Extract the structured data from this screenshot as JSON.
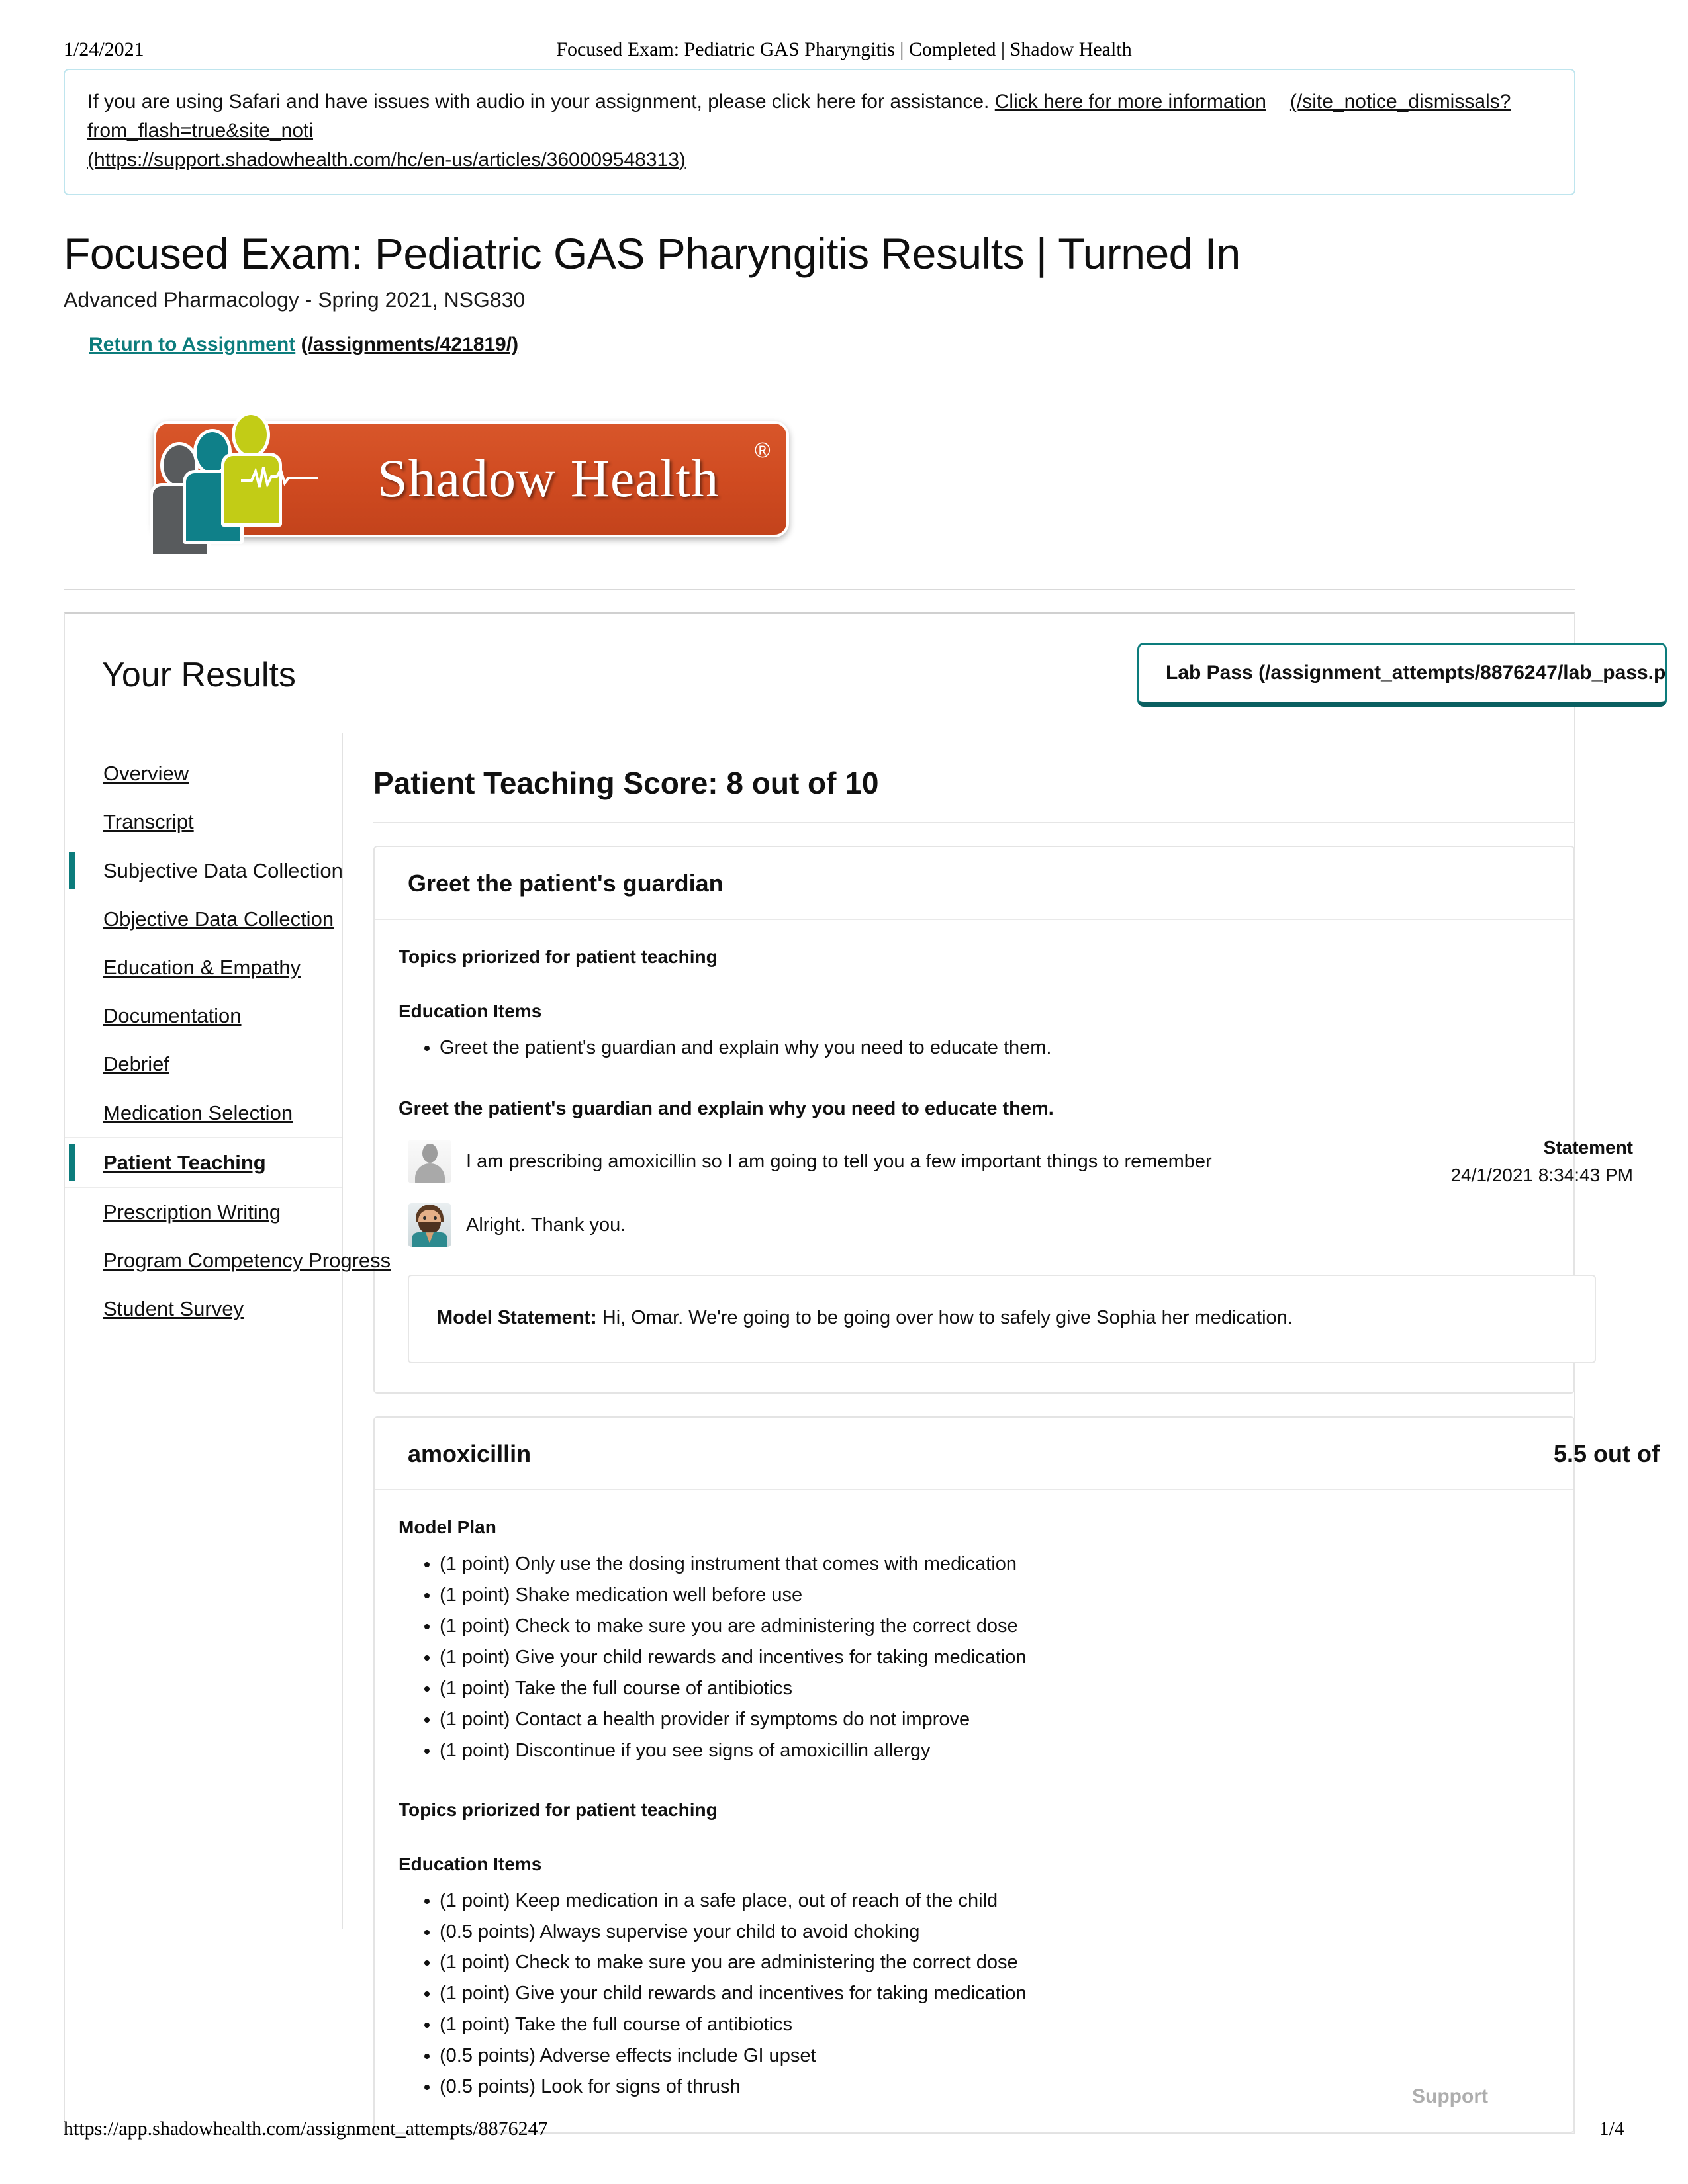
{
  "print": {
    "date": "1/24/2021",
    "header_title": "Focused Exam: Pediatric GAS Pharyngitis | Completed | Shadow Health",
    "footer_url": "https://app.shadowhealth.com/assignment_attempts/8876247",
    "page_number": "1/4"
  },
  "notice": {
    "text": "If you are using Safari and have issues with audio in your assignment, please click here for assistance.",
    "link_label": "Click here for more information",
    "link_url": "(https://support.shadowhealth.com/hc/en-us/articles/360009548313)",
    "dismiss_url": "(/site_notice_dismissals?from_flash=true&site_noti"
  },
  "header": {
    "title": "Focused Exam: Pediatric GAS Pharyngitis Results | Turned In",
    "subtitle": "Advanced Pharmacology - Spring 2021, NSG830",
    "return_link_label": "Return to Assignment",
    "return_link_url": "(/assignments/421819/)"
  },
  "logo": {
    "wordmark": "Shadow Health",
    "registered_mark": "®",
    "rx_mark": "x",
    "plate_color": "#cf4a20",
    "figure_colors": [
      "#585b5d",
      "#0f8089",
      "#c2cc16"
    ]
  },
  "results": {
    "panel_title": "Your Results",
    "lab_pass_label": "Lab Pass (/assignment_attempts/8876247/lab_pass.p",
    "accent_color": "#0c7c7c",
    "sidebar": [
      {
        "label": "Overview",
        "state": "link"
      },
      {
        "label": "Transcript",
        "state": "link"
      },
      {
        "label": "Subjective Data Collection",
        "state": "marked"
      },
      {
        "label": "Objective Data Collection",
        "state": "link"
      },
      {
        "label": "Education & Empathy",
        "state": "link"
      },
      {
        "label": "Documentation",
        "state": "link"
      },
      {
        "label": "Debrief",
        "state": "link"
      },
      {
        "label": "Medication Selection",
        "state": "link"
      },
      {
        "label": "Patient Teaching",
        "state": "active"
      },
      {
        "label": "Prescription Writing",
        "state": "link"
      },
      {
        "label": "Program Competency Progress",
        "state": "link"
      },
      {
        "label": "Student Survey",
        "state": "link"
      }
    ]
  },
  "main": {
    "score_heading": "Patient Teaching Score: 8 out of 10",
    "support_label": "Support",
    "card_greet": {
      "title": "Greet the patient's guardian",
      "topics_label": "Topics priorized for patient teaching",
      "education_label": "Education Items",
      "education_items": [
        "Greet the patient's guardian and explain why you need to educate them."
      ],
      "question_label": "Greet the patient's guardian and explain why you need to educate them.",
      "student_statement": "I am prescribing amoxicillin so I am going to tell you a few important things to remember",
      "statement_kind": "Statement",
      "statement_time": "24/1/2021 8:34:43 PM",
      "guardian_reply": "Alright. Thank you.",
      "model_statement_label": "Model Statement:",
      "model_statement_text": "Hi, Omar. We're going to be going over how to safely give Sophia her medication."
    },
    "card_amoxicillin": {
      "title": "amoxicillin",
      "score": "5.5 out of",
      "model_plan_label": "Model Plan",
      "model_plan_items": [
        "(1 point) Only use the dosing instrument that comes with medication",
        "(1 point) Shake medication well before use",
        "(1 point) Check to make sure you are administering the correct dose",
        "(1 point) Give your child rewards and incentives for taking medication",
        "(1 point) Take the full course of antibiotics",
        "(1 point) Contact a health provider if symptoms do not improve",
        "(1 point) Discontinue if you see signs of amoxicillin allergy"
      ],
      "topics_label": "Topics priorized for patient teaching",
      "education_label": "Education Items",
      "education_items": [
        "(1 point) Keep medication in a safe place, out of reach of the child",
        "(0.5 points) Always supervise your child to avoid choking",
        "(1 point) Check to make sure you are administering the correct dose",
        "(1 point) Give your child rewards and incentives for taking medication",
        "(1 point) Take the full course of antibiotics",
        "(0.5 points) Adverse effects include GI upset",
        "(0.5 points) Look for signs of thrush"
      ]
    }
  }
}
